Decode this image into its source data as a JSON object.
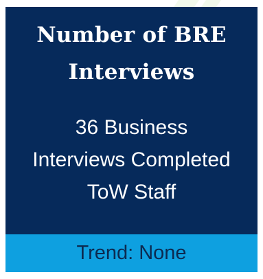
{
  "card": {
    "title_line1": "Number of BRE",
    "title_line2": "Interviews",
    "body_line1": "36 Business",
    "body_line2": "Interviews Completed",
    "body_line3": "ToW Staff",
    "footer": "Trend: None"
  },
  "colors": {
    "card_background": "#062a5b",
    "footer_background": "#0ea0e0",
    "title_text": "#ffffff",
    "footer_text": "#0c2a50"
  }
}
